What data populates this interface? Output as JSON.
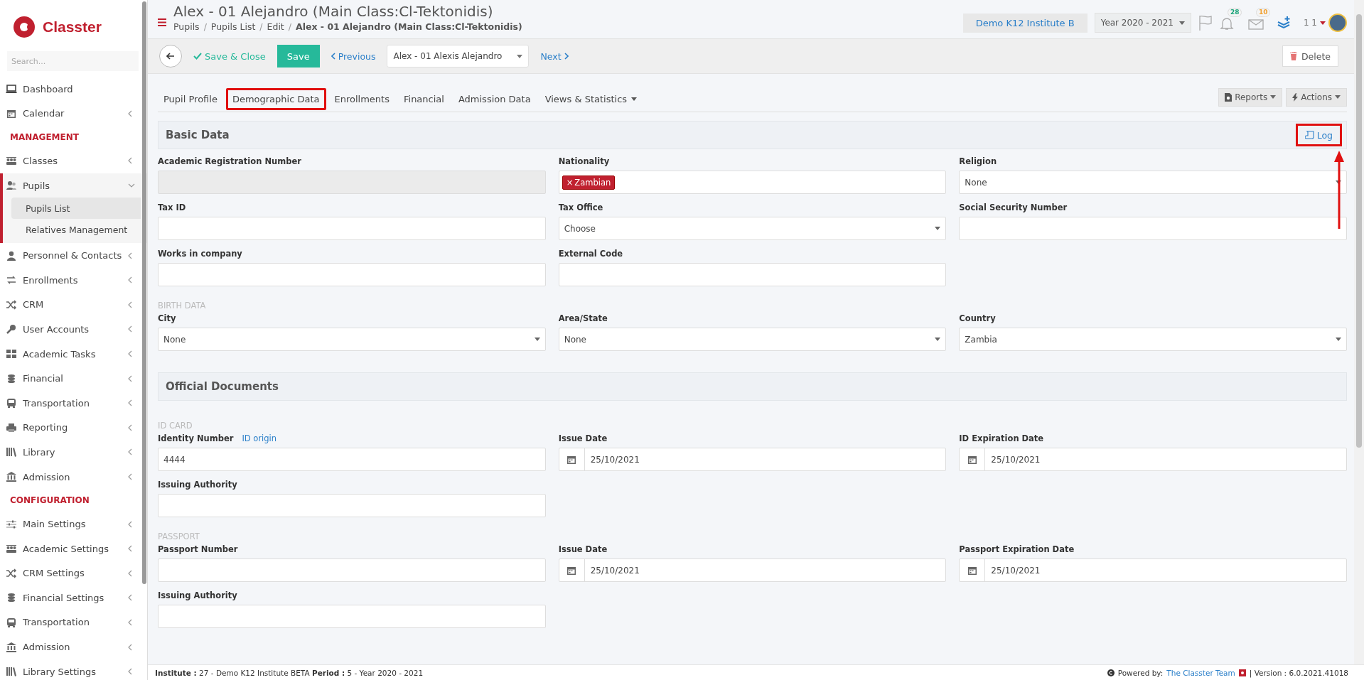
{
  "sidebar": {
    "logo_text": "Classter",
    "search": {
      "placeholder": "Search..."
    },
    "items": [
      {
        "kind": "item",
        "label": "Dashboard",
        "has_submenu": false
      },
      {
        "kind": "item",
        "label": "Calendar",
        "has_submenu": true,
        "expanded": false
      },
      {
        "kind": "heading",
        "label": "MANAGEMENT"
      },
      {
        "kind": "item",
        "label": "Classes",
        "has_submenu": true,
        "expanded": false
      },
      {
        "kind": "item",
        "label": "Pupils",
        "has_submenu": true,
        "expanded": true,
        "children": [
          {
            "label": "Pupils List",
            "selected": true
          },
          {
            "label": "Relatives Management",
            "selected": false
          }
        ]
      },
      {
        "kind": "item",
        "label": "Personnel & Contacts",
        "has_submenu": true,
        "expanded": false
      },
      {
        "kind": "item",
        "label": "Enrollments",
        "has_submenu": true,
        "expanded": false
      },
      {
        "kind": "item",
        "label": "CRM",
        "has_submenu": true,
        "expanded": false
      },
      {
        "kind": "item",
        "label": "User Accounts",
        "has_submenu": true,
        "expanded": false
      },
      {
        "kind": "item",
        "label": "Academic Tasks",
        "has_submenu": true,
        "expanded": false
      },
      {
        "kind": "item",
        "label": "Financial",
        "has_submenu": true,
        "expanded": false
      },
      {
        "kind": "item",
        "label": "Transportation",
        "has_submenu": true,
        "expanded": false
      },
      {
        "kind": "item",
        "label": "Reporting",
        "has_submenu": true,
        "expanded": false
      },
      {
        "kind": "item",
        "label": "Library",
        "has_submenu": true,
        "expanded": false
      },
      {
        "kind": "item",
        "label": "Admission",
        "has_submenu": true,
        "expanded": false
      },
      {
        "kind": "heading",
        "label": "CONFIGURATION"
      },
      {
        "kind": "item",
        "label": "Main Settings",
        "has_submenu": true,
        "expanded": false
      },
      {
        "kind": "item",
        "label": "Academic Settings",
        "has_submenu": true,
        "expanded": false
      },
      {
        "kind": "item",
        "label": "CRM Settings",
        "has_submenu": true,
        "expanded": false
      },
      {
        "kind": "item",
        "label": "Financial Settings",
        "has_submenu": true,
        "expanded": false
      },
      {
        "kind": "item",
        "label": "Transportation",
        "has_submenu": true,
        "expanded": false
      },
      {
        "kind": "item",
        "label": "Admission",
        "has_submenu": true,
        "expanded": false
      },
      {
        "kind": "item",
        "label": "Library Settings",
        "has_submenu": true,
        "expanded": false
      }
    ]
  },
  "header": {
    "breadcrumb_separator": "/",
    "title": "Alex - 01 Alejandro (Main Class:Cl-Tektonidis)",
    "breadcrumb": [
      "Pupils",
      "Pupils List",
      "Edit",
      "Alex - 01 Alejandro (Main Class:Cl-Tektonidis)"
    ],
    "institute": "Demo K12 Institute B",
    "year": "Year 2020 - 2021",
    "badges": [
      {
        "kind": "bell",
        "count": "28",
        "color": "#1aa37a"
      },
      {
        "kind": "mail",
        "count": "10",
        "color": "#f0a030"
      }
    ],
    "user": "1 1"
  },
  "toolbar": {
    "save_close": "Save & Close",
    "save": "Save",
    "previous": "Previous",
    "record_select": "Alex - 01 Alexis Alejandro",
    "next": "Next",
    "delete": "Delete"
  },
  "tabs": [
    {
      "label": "Pupil Profile",
      "selected": false,
      "dropdown": false
    },
    {
      "label": "Demographic Data",
      "selected": true,
      "dropdown": false
    },
    {
      "label": "Enrollments",
      "selected": false,
      "dropdown": false
    },
    {
      "label": "Financial",
      "selected": false,
      "dropdown": false
    },
    {
      "label": "Admission Data",
      "selected": false,
      "dropdown": false
    },
    {
      "label": "Views & Statistics",
      "selected": false,
      "dropdown": true
    }
  ],
  "tab_actions": [
    "Reports",
    "Actions"
  ],
  "sections": [
    {
      "title": "Basic Data",
      "log": "Log",
      "groups": [
        {
          "rows": [
            [
              {
                "label": "Academic Registration Number",
                "kind": "text",
                "disabled": true
              },
              {
                "label": "Nationality",
                "kind": "tags",
                "tags": [
                  "Zambian"
                ],
                "tag_remove": "×",
                "disabled": false
              },
              {
                "label": "Religion",
                "kind": "select",
                "value": "None",
                "disabled": false
              }
            ],
            [
              {
                "label": "Tax ID",
                "kind": "text",
                "disabled": false
              },
              {
                "label": "Tax Office",
                "kind": "select",
                "value": "Choose",
                "disabled": false
              },
              {
                "label": "Social Security Number",
                "kind": "text",
                "disabled": false
              }
            ],
            [
              {
                "label": "Works in company",
                "kind": "text",
                "disabled": false
              },
              {
                "label": "External Code",
                "kind": "text",
                "disabled": false
              }
            ]
          ]
        },
        {
          "caption": "BIRTH DATA",
          "rows": [
            [
              {
                "label": "City",
                "kind": "select",
                "value": "None",
                "disabled": false
              },
              {
                "label": "Area/State",
                "kind": "select",
                "value": "None",
                "disabled": false
              },
              {
                "label": "Country",
                "kind": "select",
                "value": "Zambia",
                "disabled": false
              }
            ]
          ]
        }
      ]
    },
    {
      "title": "Official Documents",
      "groups": [
        {
          "caption": "ID CARD",
          "rows": [
            [
              {
                "label": "Identity Number",
                "link": "ID origin",
                "kind": "text",
                "value": "4444",
                "disabled": false
              },
              {
                "label": "Issue Date",
                "kind": "date",
                "value": "25/10/2021",
                "disabled": false
              },
              {
                "label": "ID Expiration Date",
                "kind": "date",
                "value": "25/10/2021",
                "disabled": false
              }
            ],
            [
              {
                "label": "Issuing Authority",
                "kind": "text",
                "disabled": false
              }
            ]
          ]
        },
        {
          "caption": "PASSPORT",
          "rows": [
            [
              {
                "label": "Passport Number",
                "kind": "text",
                "disabled": false
              },
              {
                "label": "Issue Date",
                "kind": "date",
                "value": "25/10/2021",
                "disabled": false
              },
              {
                "label": "Passport Expiration Date",
                "kind": "date",
                "value": "25/10/2021",
                "disabled": false
              }
            ],
            [
              {
                "label": "Issuing Authority",
                "kind": "text",
                "disabled": false
              }
            ]
          ]
        }
      ]
    }
  ],
  "footer": {
    "info": "**Institute :** 27 - Demo K12 Institute BETA **Period :** 5 - Year 2020 - 2021",
    "powered": "Powered by:",
    "team": "The Classter Team",
    "version": "| Version : 6.0.2021.41018"
  }
}
